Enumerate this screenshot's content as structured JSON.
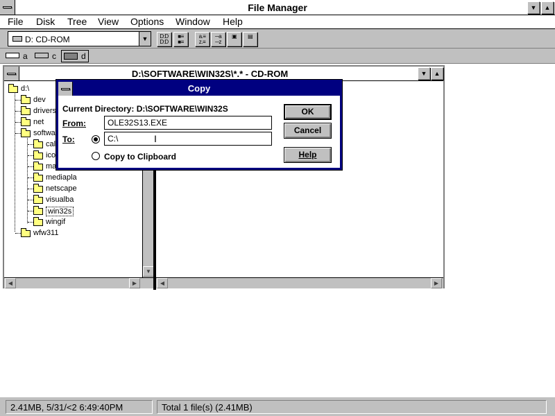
{
  "app": {
    "title": "File Manager"
  },
  "menu": [
    "File",
    "Disk",
    "Tree",
    "View",
    "Options",
    "Window",
    "Help"
  ],
  "toolbar": {
    "drive_select": "D: CD-ROM"
  },
  "drives": [
    {
      "letter": "a"
    },
    {
      "letter": "c"
    },
    {
      "letter": "d"
    }
  ],
  "child": {
    "title": "D:\\SOFTWARE\\WIN32S\\*.* - CD-ROM"
  },
  "tree": [
    {
      "label": "d:\\",
      "level": 0
    },
    {
      "label": "dev",
      "level": 1
    },
    {
      "label": "drivers",
      "level": 1
    },
    {
      "label": "net",
      "level": 1
    },
    {
      "label": "softwa",
      "level": 1
    },
    {
      "label": "cal",
      "level": 2
    },
    {
      "label": "ico",
      "level": 2
    },
    {
      "label": "ma",
      "level": 2
    },
    {
      "label": "mediapla",
      "level": 2
    },
    {
      "label": "netscape",
      "level": 2
    },
    {
      "label": "visualba",
      "level": 2
    },
    {
      "label": "win32s",
      "level": 2,
      "selected": true
    },
    {
      "label": "wingif",
      "level": 2
    },
    {
      "label": "wfw311",
      "level": 1
    }
  ],
  "dialog": {
    "title": "Copy",
    "current_dir_label": "Current Directory: D:\\SOFTWARE\\WIN32S",
    "from_label": "From:",
    "from_value": "OLE32S13.EXE",
    "to_label": "To:",
    "to_value": "C:\\",
    "clipboard_label": "Copy to Clipboard",
    "ok": "OK",
    "cancel": "Cancel",
    "help": "Help"
  },
  "status": {
    "left": "2.41MB, 5/31/<2 6:49:40PM",
    "right": "Total 1 file(s) (2.41MB)"
  }
}
